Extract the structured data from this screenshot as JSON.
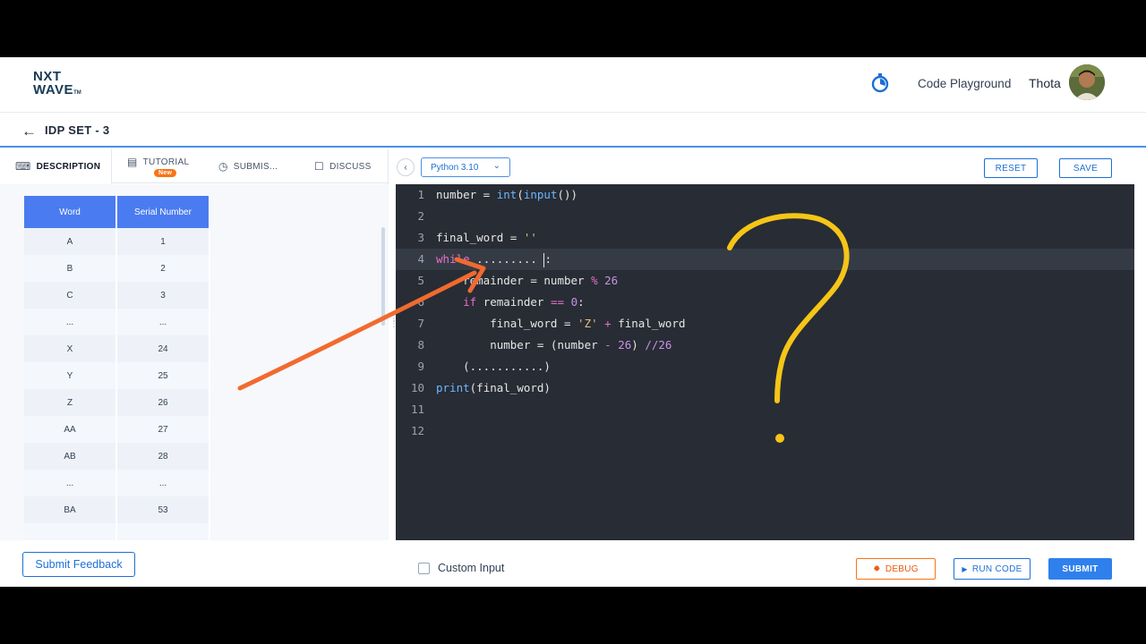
{
  "header": {
    "logo_line1": "NXT",
    "logo_line2": "WAVE",
    "logo_tm": "TM",
    "nav_link": "Code Playground",
    "user_name": "Thota"
  },
  "titlebar": {
    "back_icon": "←",
    "title": "IDP SET - 3"
  },
  "tabs": {
    "description": "DESCRIPTION",
    "tutorial": "TUTORIAL",
    "tutorial_badge": "New",
    "submissions": "SUBMIS...",
    "discuss": "DISCUSS"
  },
  "table": {
    "headers": [
      "Word",
      "Serial Number"
    ],
    "rows": [
      [
        "A",
        "1"
      ],
      [
        "B",
        "2"
      ],
      [
        "C",
        "3"
      ],
      [
        "...",
        "..."
      ],
      [
        "X",
        "24"
      ],
      [
        "Y",
        "25"
      ],
      [
        "Z",
        "26"
      ],
      [
        "AA",
        "27"
      ],
      [
        "AB",
        "28"
      ],
      [
        "...",
        "..."
      ],
      [
        "BA",
        "53"
      ],
      [
        "",
        ""
      ]
    ]
  },
  "editor": {
    "language": "Python 3.10",
    "reset_label": "RESET",
    "save_label": "SAVE",
    "line_numbers": [
      "1",
      "2",
      "3",
      "4",
      "5",
      "6",
      "7",
      "8",
      "9",
      "10",
      "11",
      "12"
    ]
  },
  "bottom": {
    "feedback_label": "Submit Feedback",
    "custom_input_label": "Custom Input",
    "debug_label": "DEBUG",
    "run_label": "RUN CODE",
    "submit_label": "SUBMIT"
  },
  "colors": {
    "accent": "#1d6fd6",
    "table_header": "#4b7bf0",
    "editor_bg": "#282c34",
    "annotation_arrow": "#f26a2e",
    "annotation_question": "#f5c518"
  }
}
